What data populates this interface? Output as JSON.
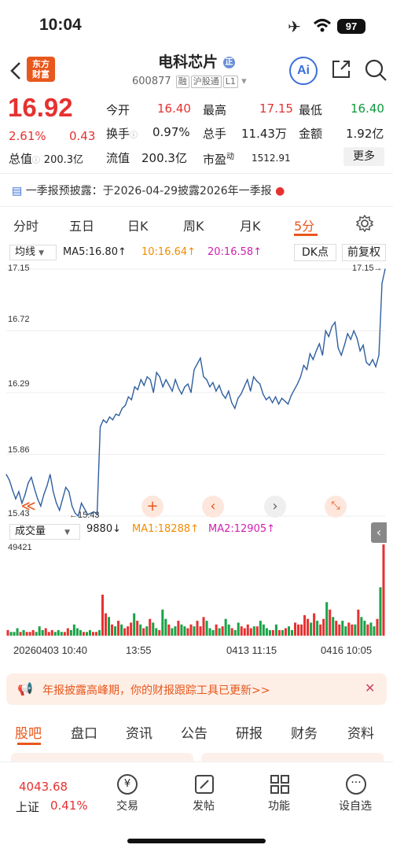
{
  "status": {
    "time": "10:04",
    "battery": "97"
  },
  "stock": {
    "name": "电科芯片",
    "badge": "正",
    "code": "600877",
    "tags": [
      "融",
      "沪股通",
      "L1"
    ],
    "logo_line1": "东方",
    "logo_line2": "财富",
    "ai": "Ai"
  },
  "quote": {
    "price": "16.92",
    "pct": "2.61%",
    "chg": "0.43",
    "open_label": "今开",
    "open": "16.40",
    "high_label": "最高",
    "high": "17.15",
    "low_label": "最低",
    "low": "16.40",
    "turnover_label": "换手",
    "turnover": "0.97%",
    "volume_label": "总手",
    "volume": "11.43万",
    "amount_label": "金额",
    "amount": "1.92亿",
    "mcap_label": "总值",
    "mcap": "200.3亿",
    "float_label": "流值",
    "float": "200.3亿",
    "pe_label": "市盈",
    "pe_sup": "动",
    "pe": "1512.91",
    "more": "更多"
  },
  "notice": "一季报预披露：于2026-04-29披露2026年一季报",
  "tabs": [
    "分时",
    "五日",
    "日K",
    "周K",
    "月K",
    "5分"
  ],
  "ma": {
    "selector": "均线",
    "ma5": "MA5:16.80↑",
    "ma10": "10:16.64↑",
    "ma20": "20:16.58↑",
    "dk": "DK点",
    "fq": "前复权"
  },
  "price_axis": [
    "17.15",
    "16.72",
    "16.29",
    "15.86",
    "15.43"
  ],
  "markers": {
    "high": "17.15→",
    "low": "←15.43"
  },
  "volume": {
    "selector": "成交量",
    "val": "9880↓",
    "ma1": "MA1:18288↑",
    "ma2": "MA2:12905↑",
    "max": "49421"
  },
  "dates": [
    "20260403 10:40",
    "13:55",
    "0413 11:15",
    "0416 10:05"
  ],
  "banner": "年报披露高峰期，你的财报跟踪工具已更新>>",
  "section_tabs": [
    "股吧",
    "盘口",
    "资讯",
    "公告",
    "研报",
    "财务",
    "资料"
  ],
  "bottom": {
    "index_val": "4043.68",
    "index_name": "上证",
    "index_pct": "0.41%",
    "items": [
      "交易",
      "发帖",
      "功能",
      "设自选"
    ]
  },
  "chart_data": {
    "type": "line",
    "ylim": [
      15.43,
      17.15
    ],
    "series": [
      {
        "values": [
          15.72,
          15.68,
          15.61,
          15.55,
          15.6,
          15.52,
          15.58,
          15.66,
          15.7,
          15.62,
          15.55,
          15.5,
          15.58,
          15.64,
          15.72,
          15.6,
          15.52,
          15.47,
          15.55,
          15.63,
          15.6,
          15.5,
          15.45,
          15.43,
          15.52,
          15.48,
          15.44,
          15.45,
          15.46,
          15.44,
          16.05,
          16.1,
          16.08,
          16.12,
          16.1,
          16.14,
          16.13,
          16.18,
          16.2,
          16.26,
          16.24,
          16.33,
          16.31,
          16.38,
          16.34,
          16.4,
          16.38,
          16.29,
          16.43,
          16.4,
          16.33,
          16.38,
          16.34,
          16.3,
          16.38,
          16.32,
          16.28,
          16.33,
          16.35,
          16.29,
          16.45,
          16.49,
          16.53,
          16.4,
          16.38,
          16.33,
          16.36,
          16.3,
          16.34,
          16.28,
          16.25,
          16.3,
          16.22,
          16.18,
          16.25,
          16.28,
          16.33,
          16.38,
          16.3,
          16.4,
          16.37,
          16.35,
          16.28,
          16.24,
          16.26,
          16.22,
          16.26,
          16.21,
          16.25,
          16.23,
          16.21,
          16.27,
          16.31,
          16.35,
          16.4,
          16.48,
          16.45,
          16.56,
          16.52,
          16.58,
          16.63,
          16.55,
          16.72,
          16.68,
          16.75,
          16.78,
          16.6,
          16.55,
          16.62,
          16.7,
          16.66,
          16.72,
          16.67,
          16.58,
          16.62,
          16.5,
          16.48,
          16.52,
          16.47,
          16.55,
          17.05,
          17.15
        ]
      }
    ],
    "volume": [
      3,
      2,
      2,
      4,
      2,
      3,
      2,
      2,
      3,
      2,
      5,
      3,
      4,
      2,
      3,
      2,
      3,
      2,
      2,
      4,
      3,
      6,
      4,
      3,
      2,
      2,
      3,
      2,
      2,
      3,
      22,
      12,
      10,
      6,
      5,
      8,
      6,
      4,
      5,
      7,
      12,
      8,
      6,
      4,
      5,
      9,
      7,
      4,
      3,
      14,
      9,
      6,
      4,
      5,
      8,
      6,
      5,
      4,
      6,
      5,
      8,
      5,
      10,
      8,
      4,
      3,
      6,
      4,
      5,
      9,
      6,
      4,
      3,
      7,
      5,
      4,
      6,
      4,
      5,
      5,
      8,
      6,
      4,
      3,
      3,
      6,
      3,
      3,
      4,
      5,
      3,
      7,
      6,
      6,
      11,
      9,
      7,
      12,
      8,
      6,
      9,
      18,
      14,
      10,
      8,
      6,
      8,
      5,
      7,
      6,
      6,
      14,
      10,
      8,
      6,
      7,
      5,
      9,
      26,
      49
    ]
  }
}
